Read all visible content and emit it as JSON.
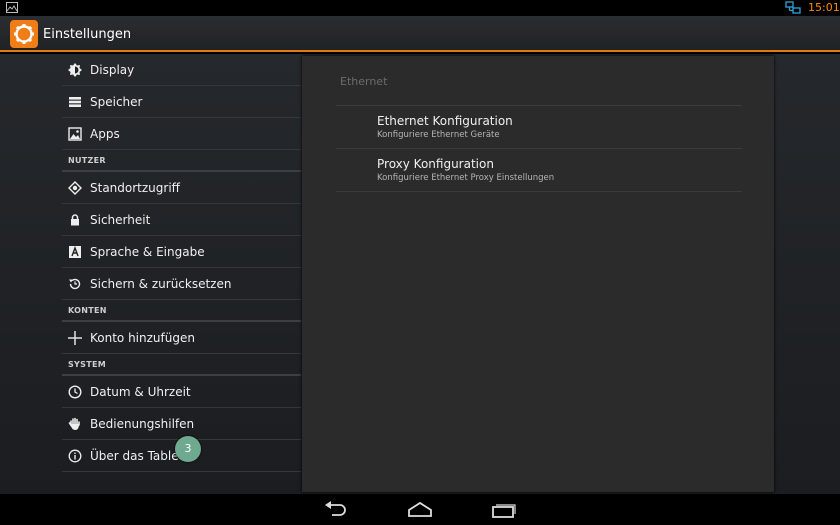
{
  "status": {
    "time": "15:01"
  },
  "actionbar": {
    "title": "Einstellungen",
    "icon": "settings-gear-icon"
  },
  "sidebar": {
    "items": [
      {
        "label": "Display",
        "icon": "brightness-icon"
      },
      {
        "label": "Speicher",
        "icon": "storage-icon"
      },
      {
        "label": "Apps",
        "icon": "apps-image-icon"
      }
    ],
    "sections": [
      {
        "title": "NUTZER",
        "items": [
          {
            "label": "Standortzugriff",
            "icon": "location-icon"
          },
          {
            "label": "Sicherheit",
            "icon": "lock-icon"
          },
          {
            "label": "Sprache & Eingabe",
            "icon": "language-icon"
          },
          {
            "label": "Sichern & zurücksetzen",
            "icon": "restore-icon"
          }
        ]
      },
      {
        "title": "KONTEN",
        "items": [
          {
            "label": "Konto hinzufügen",
            "icon": "plus-icon"
          }
        ]
      },
      {
        "title": "SYSTEM",
        "items": [
          {
            "label": "Datum & Uhrzeit",
            "icon": "clock-icon"
          },
          {
            "label": "Bedienungshilfen",
            "icon": "hand-icon"
          },
          {
            "label": "Über das Tablet",
            "icon": "info-icon"
          }
        ]
      }
    ]
  },
  "panel": {
    "title": "Ethernet",
    "prefs": [
      {
        "title": "Ethernet Konfiguration",
        "summary": "Konfiguriere Ethernet Geräte"
      },
      {
        "title": "Proxy Konfiguration",
        "summary": "Konfiguriere Ethernet Proxy Einstellungen"
      }
    ]
  },
  "badge": {
    "value": "3"
  },
  "colors": {
    "accent": "#e57a0e",
    "time": "#ff8a00",
    "badge": "#6fa98f"
  }
}
